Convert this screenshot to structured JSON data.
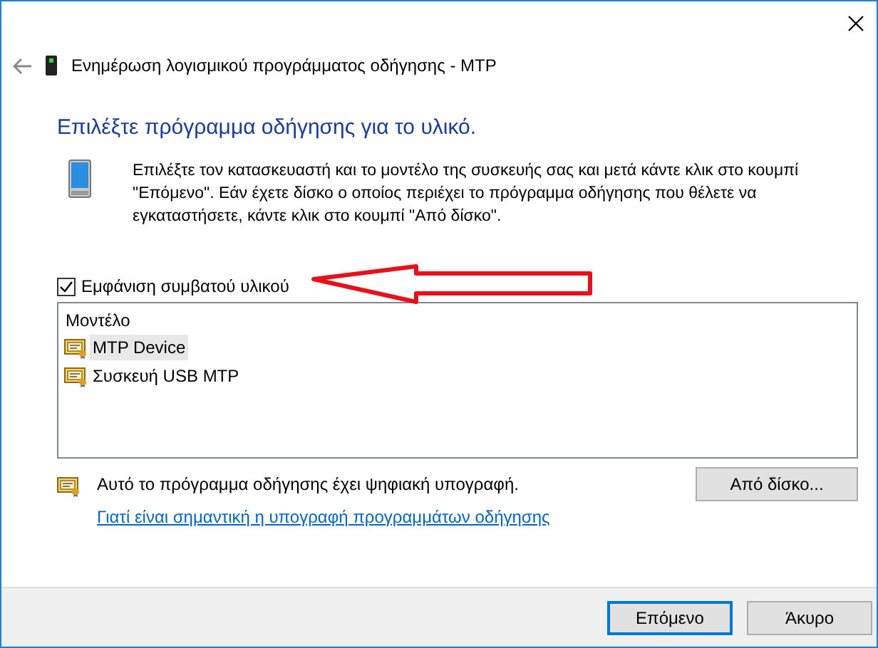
{
  "window": {
    "title": "Ενημέρωση λογισμικού προγράμματος οδήγησης - MTP"
  },
  "heading": "Επιλέξτε πρόγραμμα οδήγησης για το υλικό.",
  "description": "Επιλέξτε τον κατασκευαστή και το μοντέλο της συσκευής σας και μετά κάντε κλικ στο κουμπί \"Επόμενο\". Εάν έχετε δίσκο ο οποίος περιέχει το πρόγραμμα οδήγησης που θέλετε να εγκαταστήσετε, κάντε κλικ στο κουμπί \"Από δίσκο\".",
  "show_compatible": {
    "label": "Εμφάνιση συμβατού υλικού",
    "checked": true
  },
  "model_list": {
    "header": "Μοντέλο",
    "items": [
      {
        "label": "MTP Device",
        "selected": true
      },
      {
        "label": "Συσκευή USB MTP",
        "selected": false
      }
    ]
  },
  "signature": {
    "text": "Αυτό το πρόγραμμα οδήγησης έχει ψηφιακή υπογραφή.",
    "link": "Γιατί είναι σημαντική η υπογραφή προγραμμάτων οδήγησης"
  },
  "have_disk_button": "Από δίσκο...",
  "buttons": [
    {
      "label": "Επόμενο",
      "default": true
    },
    {
      "label": "Άκυρο",
      "default": false
    }
  ]
}
